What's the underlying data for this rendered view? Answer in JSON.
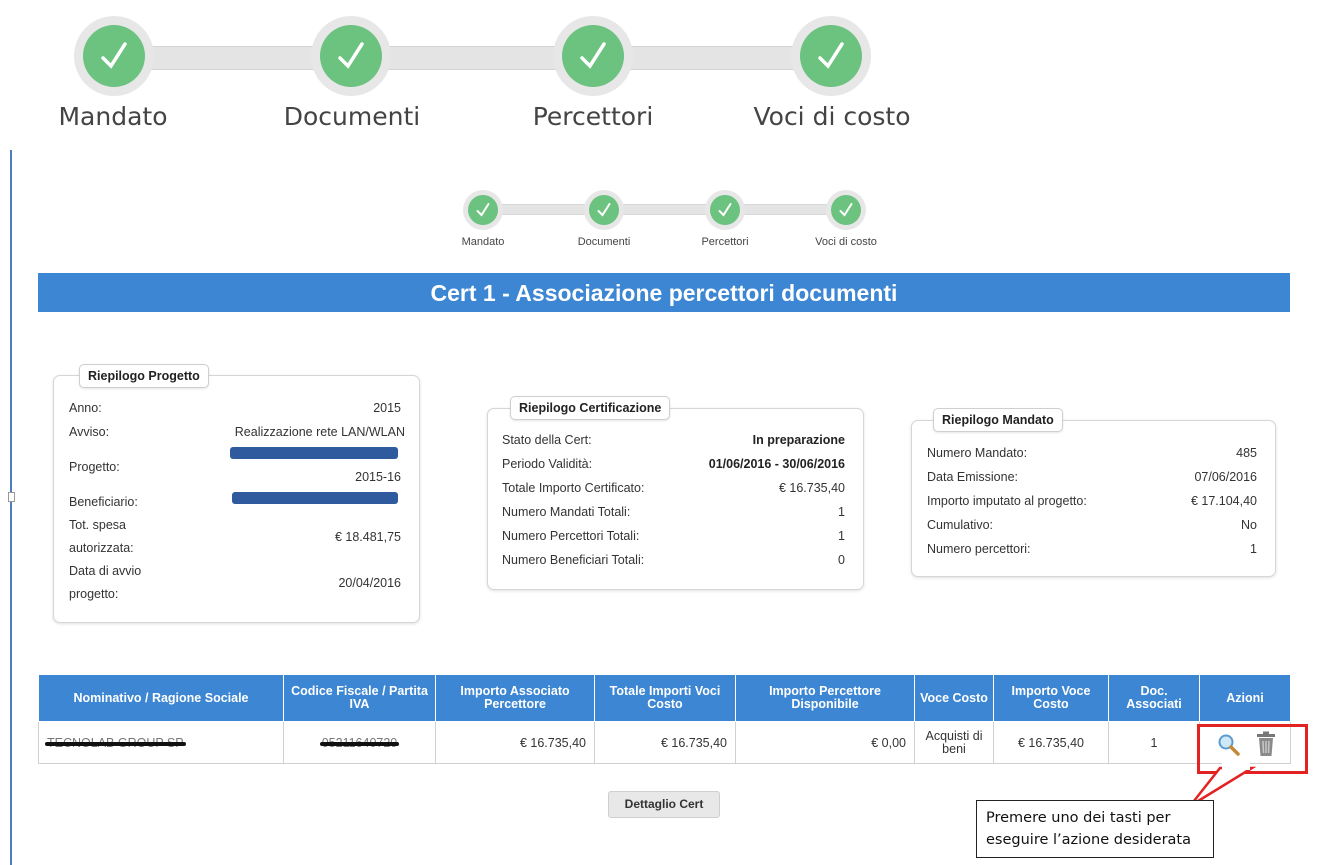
{
  "big_stepper": {
    "steps": [
      {
        "label": "Mandato"
      },
      {
        "label": "Documenti"
      },
      {
        "label": "Percettori"
      },
      {
        "label": "Voci di costo"
      }
    ]
  },
  "small_stepper": {
    "steps": [
      {
        "label": "Mandato"
      },
      {
        "label": "Documenti"
      },
      {
        "label": "Percettori"
      },
      {
        "label": "Voci di costo"
      }
    ]
  },
  "page_title": "Cert 1 - Associazione percettori documenti",
  "riepilogo_progetto": {
    "title": "Riepilogo Progetto",
    "anno_label": "Anno:",
    "anno_value": "2015",
    "avviso_label": "Avviso:",
    "avviso_value": "Realizzazione rete LAN/WLAN",
    "progetto_label": "Progetto:",
    "progetto_value": "2015-16",
    "beneficiario_label": "Beneficiario:",
    "spesa_label_1": "Tot. spesa",
    "spesa_label_2": "autorizzata:",
    "spesa_value": "€ 18.481,75",
    "avvio_label_1": "Data di avvio",
    "avvio_label_2": "progetto:",
    "avvio_value": "20/04/2016"
  },
  "riepilogo_certificazione": {
    "title": "Riepilogo Certificazione",
    "rows": [
      {
        "label": "Stato della Cert:",
        "value": "In preparazione"
      },
      {
        "label": "Periodo Validità:",
        "value": "01/06/2016 - 30/06/2016"
      },
      {
        "label": "Totale Importo Certificato:",
        "value": "€ 16.735,40"
      },
      {
        "label": "Numero Mandati Totali:",
        "value": "1"
      },
      {
        "label": "Numero Percettori Totali:",
        "value": "1"
      },
      {
        "label": "Numero Beneficiari Totali:",
        "value": "0"
      }
    ]
  },
  "riepilogo_mandato": {
    "title": "Riepilogo Mandato",
    "rows": [
      {
        "label": "Numero Mandato:",
        "value": "485"
      },
      {
        "label": "Data Emissione:",
        "value": "07/06/2016"
      },
      {
        "label": "Importo imputato al progetto:",
        "value": "€ 17.104,40"
      },
      {
        "label": "Cumulativo:",
        "value": "No"
      },
      {
        "label": "Numero percettori:",
        "value": "1"
      }
    ]
  },
  "table": {
    "headers": [
      "Nominativo / Ragione Sociale",
      "Codice Fiscale / Partita IVA",
      "Importo Associato Percettore",
      "Totale Importi Voci Costo",
      "Importo Percettore Disponibile",
      "Voce Costo",
      "Importo Voce Costo",
      "Doc. Associati",
      "Azioni"
    ],
    "row": {
      "nominativo": "TECNOLAB GROUP SP",
      "codice_fiscale": "05211640720",
      "importo_associato": "€ 16.735,40",
      "totale_importi": "€ 16.735,40",
      "importo_disponibile": "€ 0,00",
      "voce_costo": "Acquisti di beni",
      "importo_voce": "€ 16.735,40",
      "doc_associati": "1"
    }
  },
  "dettaglio_button": "Dettaglio Cert",
  "callout": {
    "line1": "Premere uno dei tasti per",
    "line2": "eseguire l’azione desiderata"
  },
  "colors": {
    "accent": "#3c86d3",
    "step_done": "#6cc27f",
    "highlight": "#e32222"
  },
  "icons": [
    "check-icon",
    "magnifier-icon",
    "trash-icon"
  ]
}
